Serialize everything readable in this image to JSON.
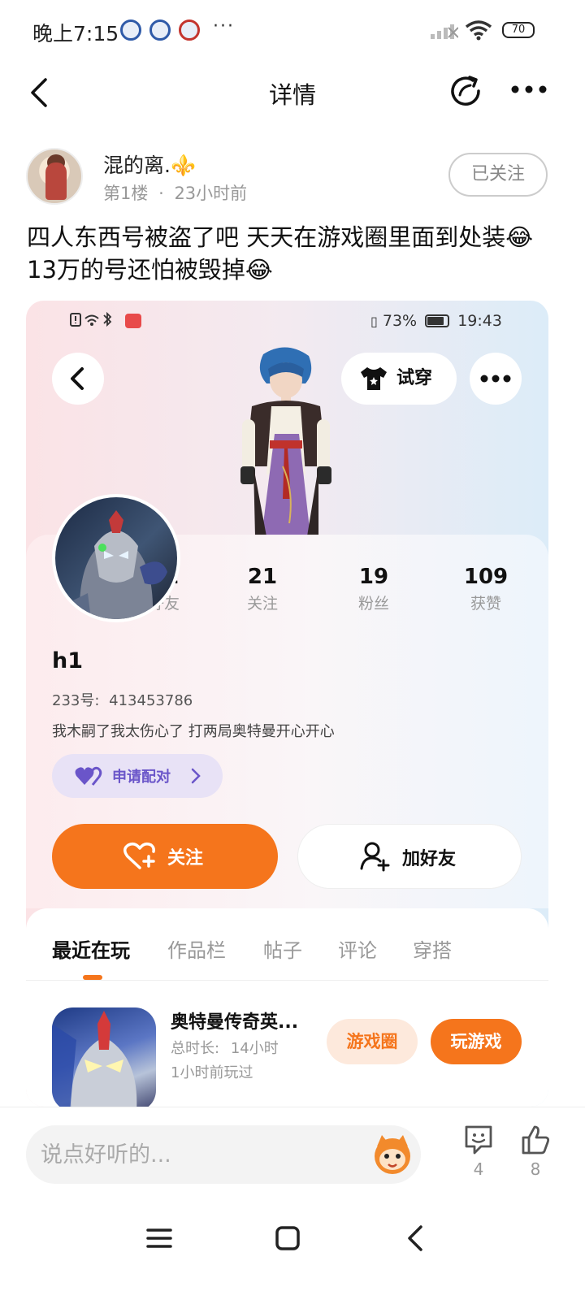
{
  "status_bar": {
    "time": "晚上7:15",
    "overflow": "···",
    "battery": "70"
  },
  "header": {
    "title": "详情",
    "back_icon": "chevron-left-icon",
    "share_icon": "share-icon",
    "more_icon": "more-icon"
  },
  "post": {
    "author_name": "混的离.⚜️",
    "floor": "第1楼",
    "separator": "·",
    "time_ago": "23小时前",
    "follow_label": "已关注",
    "text": "四人东西号被盗了吧 天天在游戏圈里面到处装😂 13万的号还怕被毁掉😂"
  },
  "screenshot": {
    "status": {
      "battery_percent": "73%",
      "time": "19:43"
    },
    "try_on_label": "试穿",
    "stats": [
      {
        "value": "21",
        "label": "好友"
      },
      {
        "value": "21",
        "label": "关注"
      },
      {
        "value": "19",
        "label": "粉丝"
      },
      {
        "value": "109",
        "label": "获赞"
      }
    ],
    "profile": {
      "name": "h1",
      "id_label": "233号:",
      "id_value": "413453786",
      "bio": "我木嗣了我太伤心了 打两局奥特曼开心开心",
      "pair_label": "申请配对"
    },
    "follow_label": "关注",
    "add_friend_label": "加好友",
    "tabs": [
      "最近在玩",
      "作品栏",
      "帖子",
      "评论",
      "穿搭"
    ],
    "active_tab": "最近在玩",
    "game": {
      "name": "奥特曼传奇英...",
      "duration_label": "总时长:",
      "duration_value": "14小时",
      "last_played": "1小时前玩过",
      "circle_label": "游戏圈",
      "play_label": "玩游戏"
    }
  },
  "bottom_bar": {
    "comment_placeholder": "说点好听的...",
    "comment_count": "4",
    "like_count": "8"
  },
  "colors": {
    "accent_orange": "#f5751c",
    "pair_purple": "#6a55c9"
  }
}
